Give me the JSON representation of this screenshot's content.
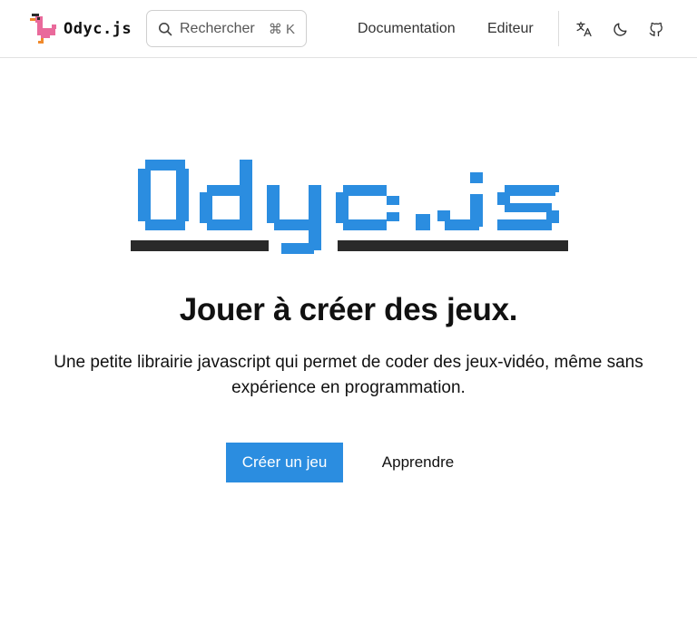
{
  "header": {
    "brand_name": "Odyc.js",
    "search": {
      "placeholder": "Rechercher",
      "shortcut": "⌘ K"
    },
    "nav": {
      "documentation": "Documentation",
      "editor": "Editeur"
    },
    "icons": {
      "language": "translate-icon",
      "theme": "moon-icon",
      "github": "github-icon"
    }
  },
  "hero": {
    "logo_text": "Odyc.js",
    "title": "Jouer à créer des jeux.",
    "description": "Une petite librairie javascript qui permet de coder des jeux-vidéo, même sans expérience en programmation.",
    "primary_button": "Créer un jeu",
    "secondary_button": "Apprendre"
  },
  "colors": {
    "accent": "#2b8de0",
    "logo_shadow": "#2a2a2a",
    "duck_pink": "#e96a9b",
    "duck_orange": "#f08a2c"
  }
}
